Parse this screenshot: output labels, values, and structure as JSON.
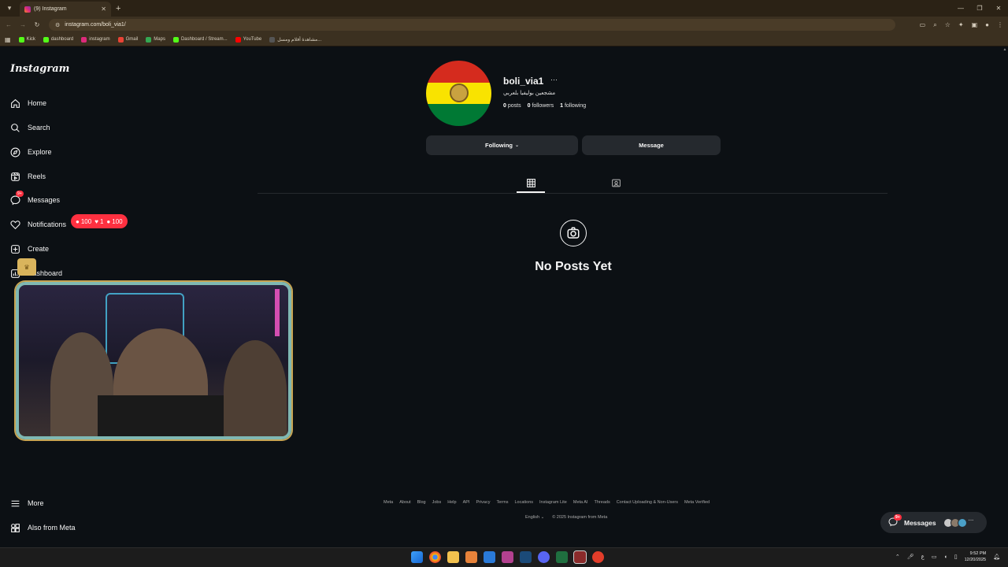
{
  "browser": {
    "tab_title": "(9) Instagram",
    "url": "instagram.com/boli_via1/",
    "bookmarks": [
      {
        "label": "Kick",
        "color": "#53fc18"
      },
      {
        "label": "dashboard",
        "color": "#53fc18"
      },
      {
        "label": "instagram",
        "color": "#dd2a7b"
      },
      {
        "label": "Gmail",
        "color": "#ea4335"
      },
      {
        "label": "Maps",
        "color": "#34a853"
      },
      {
        "label": "Dashboard / Stream...",
        "color": "#53fc18"
      },
      {
        "label": "YouTube",
        "color": "#ff0000"
      },
      {
        "label": "مشاهدة أفلام ومسل...",
        "color": "#333333"
      }
    ]
  },
  "sidebar": {
    "logo": "Instagram",
    "items": [
      {
        "label": "Home",
        "icon": "home-icon"
      },
      {
        "label": "Search",
        "icon": "search-icon"
      },
      {
        "label": "Explore",
        "icon": "compass-icon"
      },
      {
        "label": "Reels",
        "icon": "reels-icon"
      },
      {
        "label": "Messages",
        "icon": "messenger-icon"
      },
      {
        "label": "Notifications",
        "icon": "heart-icon"
      },
      {
        "label": "Create",
        "icon": "plus-square-icon"
      },
      {
        "label": "Dashboard",
        "icon": "chart-icon"
      }
    ],
    "messages_badge": "9+",
    "more_label": "More",
    "also_meta_label": "Also from Meta"
  },
  "notification_pill": {
    "comments": "100",
    "likes": "1",
    "follows": "100"
  },
  "profile": {
    "username": "boli_via1",
    "more": "···",
    "bio": "مشجعين بوليفيا بلعربي",
    "stats": {
      "posts_count": "0",
      "posts_label": "posts",
      "followers_count": "0",
      "followers_label": "followers",
      "following_count": "1",
      "following_label": "following"
    },
    "following_button": "Following",
    "message_button": "Message",
    "empty_state": "No Posts Yet",
    "flag_colors": [
      "#d52b1e",
      "#f9e300",
      "#007934"
    ]
  },
  "footer": {
    "links": [
      "Meta",
      "About",
      "Blog",
      "Jobs",
      "Help",
      "API",
      "Privacy",
      "Terms",
      "Locations",
      "Instagram Lite",
      "Meta AI",
      "Threads",
      "Contact Uploading & Non-Users",
      "Meta Verified"
    ],
    "language": "English",
    "copyright": "© 2025 Instagram from Meta"
  },
  "floating_messages": {
    "label": "Messages",
    "badge": "9+"
  },
  "taskbar": {
    "time": "9:52 PM",
    "date": "12/20/2025",
    "lang": "ع"
  }
}
